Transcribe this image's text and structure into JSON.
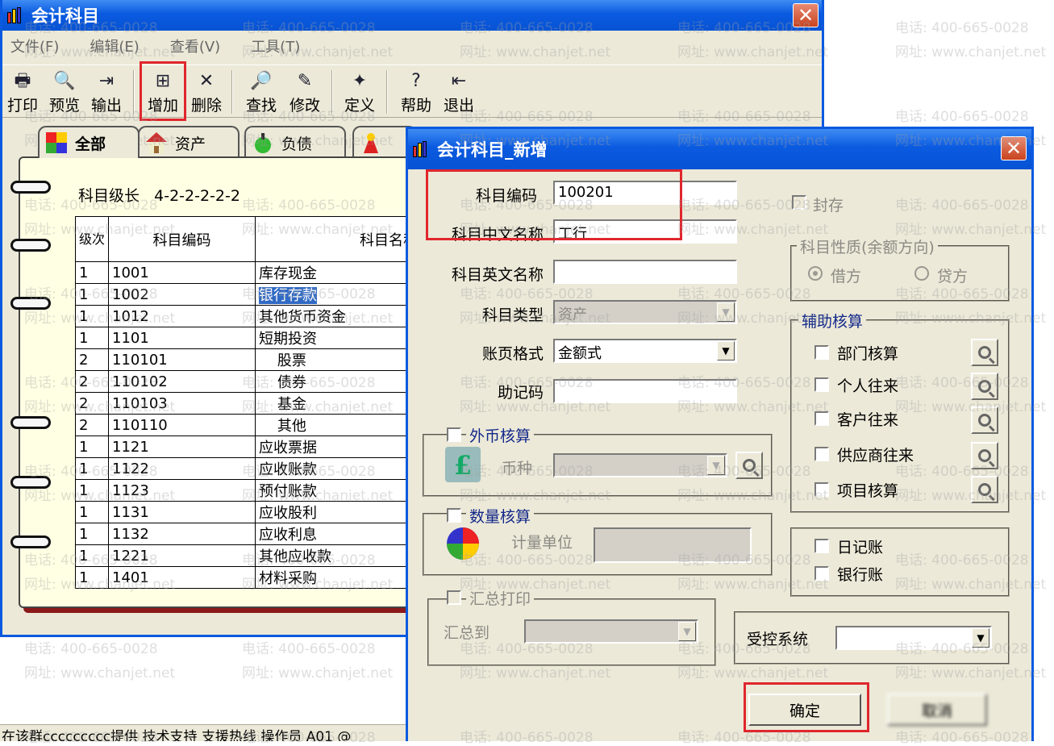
{
  "main_window": {
    "title": "会计科目",
    "close": "✕",
    "menu": [
      "文件(F)",
      "编辑(E)",
      "查看(V)",
      "工具(T)"
    ],
    "toolbar": [
      {
        "label": "打印",
        "icon": "printer-icon",
        "glyph": "🖶"
      },
      {
        "label": "预览",
        "icon": "preview-icon",
        "glyph": "🔍"
      },
      {
        "label": "输出",
        "icon": "export-icon",
        "glyph": "⇥"
      },
      {
        "label": "增加",
        "icon": "add-icon",
        "glyph": "⊞"
      },
      {
        "label": "删除",
        "icon": "delete-icon",
        "glyph": "✕"
      },
      {
        "label": "查找",
        "icon": "find-icon",
        "glyph": "🔎"
      },
      {
        "label": "修改",
        "icon": "edit-icon",
        "glyph": "✎"
      },
      {
        "label": "定义",
        "icon": "wand-icon",
        "glyph": "✦"
      },
      {
        "label": "帮助",
        "icon": "help-icon",
        "glyph": "?"
      },
      {
        "label": "退出",
        "icon": "exit-icon",
        "glyph": "⇤"
      }
    ],
    "tabs": [
      "全部",
      "资产",
      "负债"
    ],
    "level_label": "科目级长",
    "level_value": "4-2-2-2-2-2",
    "table": {
      "headers": [
        "级次",
        "科目编码",
        "科目名称"
      ],
      "rows": [
        {
          "level": "1",
          "code": "1001",
          "name": "库存现金"
        },
        {
          "level": "1",
          "code": "1002",
          "name": "银行存款"
        },
        {
          "level": "1",
          "code": "1012",
          "name": "其他货币资金"
        },
        {
          "level": "1",
          "code": "1101",
          "name": "短期投资"
        },
        {
          "level": "2",
          "code": "110101",
          "name": "股票"
        },
        {
          "level": "2",
          "code": "110102",
          "name": "债券"
        },
        {
          "level": "2",
          "code": "110103",
          "name": "基金"
        },
        {
          "level": "2",
          "code": "110110",
          "name": "其他"
        },
        {
          "level": "1",
          "code": "1121",
          "name": "应收票据"
        },
        {
          "level": "1",
          "code": "1122",
          "name": "应收账款"
        },
        {
          "level": "1",
          "code": "1123",
          "name": "预付账款"
        },
        {
          "level": "1",
          "code": "1131",
          "name": "应收股利"
        },
        {
          "level": "1",
          "code": "1132",
          "name": "应收利息"
        },
        {
          "level": "1",
          "code": "1221",
          "name": "其他应收款"
        },
        {
          "level": "1",
          "code": "1401",
          "name": "材料采购"
        }
      ]
    },
    "status": "在该群ccccccccc提供 技术支持 支援热线 操作员 A01 @"
  },
  "dialog": {
    "title": "会计科目_新增",
    "close": "✕",
    "code_label": "科目编码",
    "code_value": "100201",
    "cn_name_label": "科目中文名称",
    "cn_name_value": "工行",
    "en_name_label": "科目英文名称",
    "en_name_value": "",
    "type_label": "科目类型",
    "type_value": "资产",
    "format_label": "账页格式",
    "format_value": "金额式",
    "mnemonic_label": "助记码",
    "mnemonic_value": "",
    "sealed_label": "封存",
    "nature_title": "科目性质(余额方向)",
    "debit": "借方",
    "credit": "贷方",
    "aux_title": "辅助核算",
    "aux_items": [
      "部门核算",
      "个人往来",
      "客户往来",
      "供应商往来",
      "项目核算"
    ],
    "journal": "日记账",
    "bank_journal": "银行账",
    "fx_title": "外币核算",
    "currency_label": "币种",
    "qty_title": "数量核算",
    "unit_label": "计量单位",
    "summary_title": "汇总打印",
    "summary_to": "汇总到",
    "controlled_label": "受控系统",
    "ok": "确定",
    "cancel": "取消"
  },
  "watermark": {
    "phone": "电话: 400-665-0028",
    "site": "网址: www.chanjet.net"
  },
  "colors": {
    "title_blue": "#0a5ae0",
    "highlight_red": "#e0262d",
    "selection": "#316ac5"
  }
}
